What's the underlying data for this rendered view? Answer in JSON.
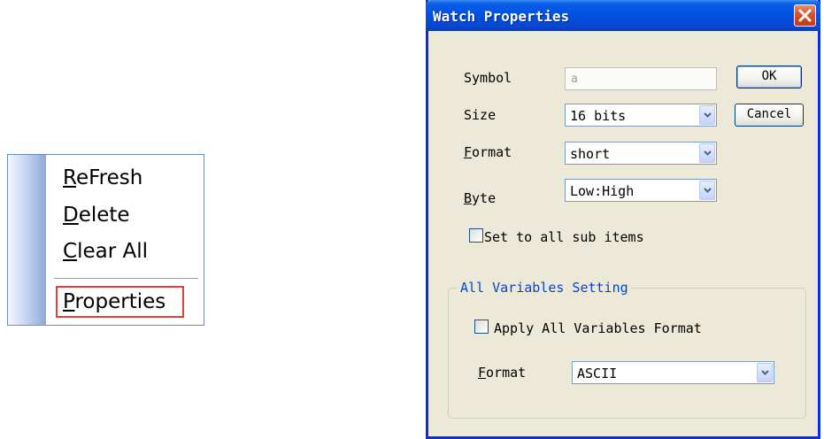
{
  "context_menu": {
    "items": [
      {
        "label": "ReFresh"
      },
      {
        "label": "Delete"
      },
      {
        "label": "Clear All"
      },
      {
        "label": "Properties"
      }
    ],
    "highlight_color": "#e0413f"
  },
  "dialog": {
    "title": "Watch Properties",
    "symbol": {
      "label": "Symbol",
      "value": "a"
    },
    "size": {
      "label": "Size",
      "value": "16 bits"
    },
    "format": {
      "label": "Format",
      "value": "short"
    },
    "byte": {
      "label": "Byte",
      "value": "Low:High"
    },
    "set_all_sub": {
      "label": "Set to all sub items",
      "checked": false
    },
    "ok_label": "OK",
    "cancel_label": "Cancel",
    "group": {
      "title": "All Variables Setting",
      "apply_all": {
        "label": "Apply All Variables Format",
        "checked": false
      },
      "format": {
        "label": "Format",
        "value": "ASCII"
      }
    },
    "colors": {
      "titlebar": "#0050e0",
      "close": "#d9542f",
      "body": "#ece9d8",
      "group_title": "#0046d5"
    }
  }
}
